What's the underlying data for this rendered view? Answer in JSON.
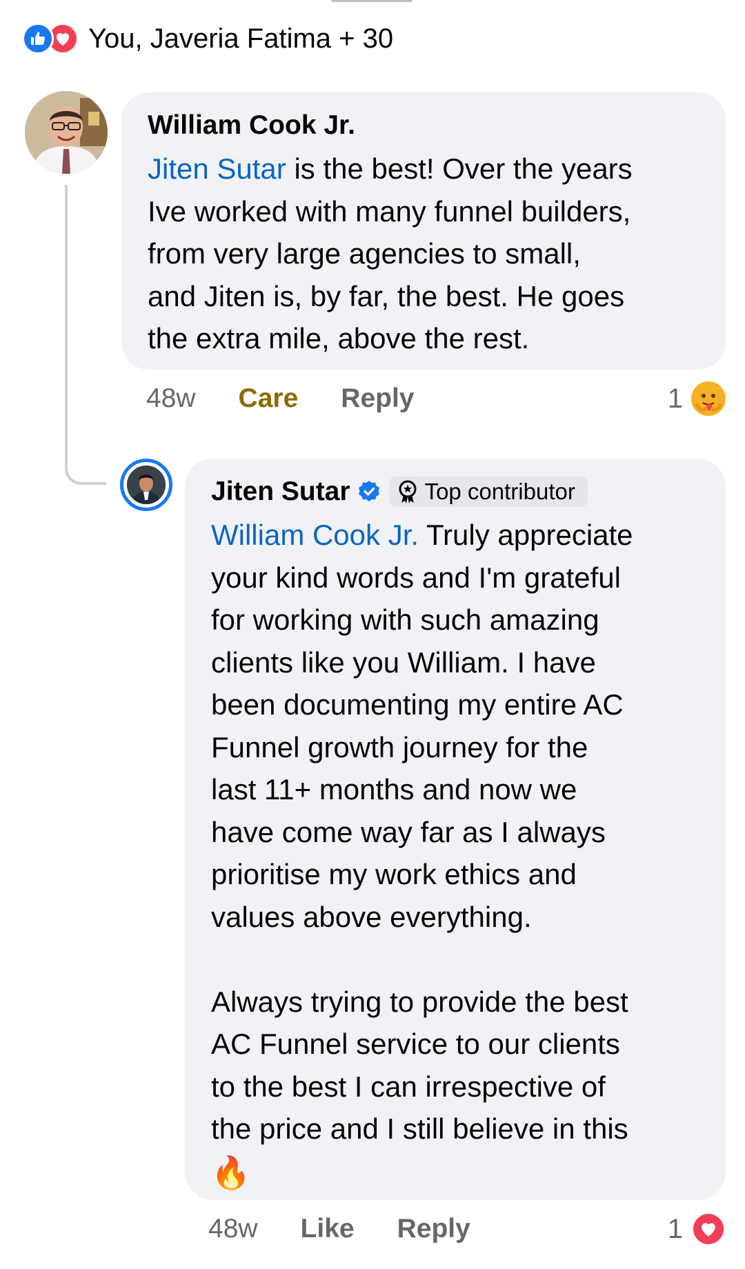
{
  "reaction_summary": {
    "text": "You, Javeria Fatima + 30",
    "icons": [
      "like-icon",
      "love-icon"
    ]
  },
  "comment": {
    "author": "William Cook Jr.",
    "mention": "Jiten Sutar",
    "text_lines": [
      " is the best! Over the years",
      "Ive worked with many funnel builders,",
      "from very large agencies to small,",
      "and Jiten is, by far, the best. He goes",
      "the extra mile, above the rest."
    ],
    "timestamp": "48w",
    "action_care": "Care",
    "action_reply": "Reply",
    "reaction_count": "1",
    "reaction_icon": "care-icon"
  },
  "reply": {
    "author": "Jiten Sutar",
    "verified_icon": "verified-icon",
    "badge_label": "Top contributor",
    "mention": "William Cook Jr.",
    "text_lines": [
      " Truly appreciate",
      "your kind words and I'm grateful",
      "for working with such amazing",
      "clients like you William. I have",
      "been documenting my entire AC",
      "Funnel growth journey for the",
      "last 11+ months and now we",
      "have come way far as I always",
      "prioritise my work ethics and",
      "values above everything.",
      "",
      "Always trying to provide the best",
      "AC Funnel service to our clients",
      "to the best I can irrespective of",
      "the price and I still believe in this"
    ],
    "emoji": "🔥",
    "timestamp": "48w",
    "action_like": "Like",
    "action_reply": "Reply",
    "reaction_count": "1",
    "reaction_icon": "love-icon"
  },
  "colors": {
    "link": "#0b65c2",
    "bubble": "#f0f2f5",
    "meta": "#65676b",
    "care": "#8b6a00",
    "like_blue": "#1877f2",
    "love_red": "#f33e58"
  }
}
